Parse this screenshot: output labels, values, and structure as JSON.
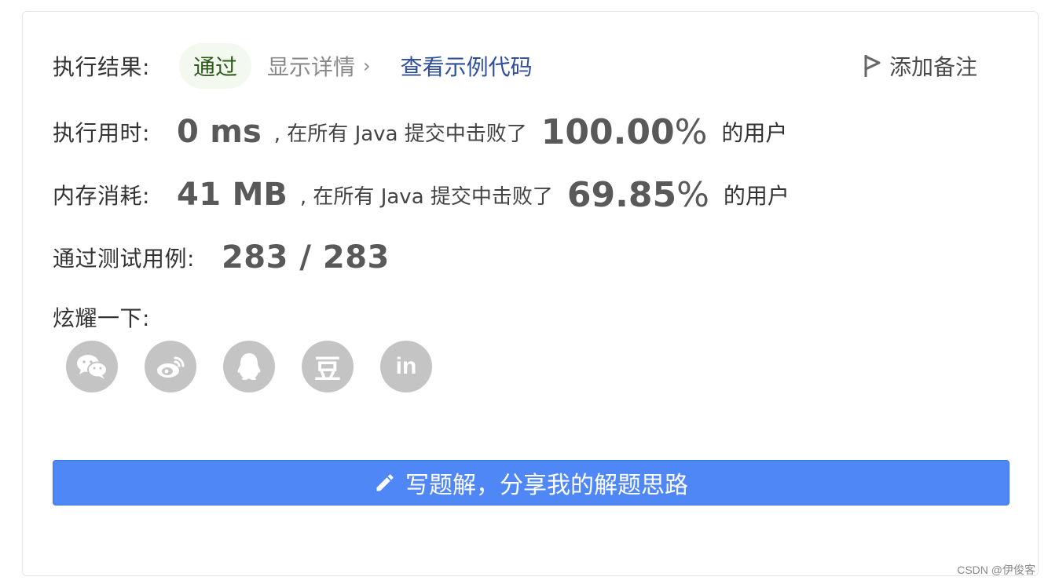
{
  "result": {
    "label": "执行结果:",
    "status": "通过",
    "details_label": "显示详情",
    "details_chevron": "›",
    "example_code_label": "查看示例代码",
    "add_note_label": "添加备注"
  },
  "runtime": {
    "label": "执行用时:",
    "value": "0",
    "unit": "ms",
    "mid_text": ", 在所有 Java 提交中击败了",
    "percent_value": "100.00",
    "percent_sign": "%",
    "suffix": "的用户"
  },
  "memory": {
    "label": "内存消耗:",
    "value": "41",
    "unit": "MB",
    "mid_text": ", 在所有 Java 提交中击败了",
    "percent_value": "69.85",
    "percent_sign": "%",
    "suffix": "的用户"
  },
  "tests": {
    "label": "通过测试用例:",
    "value": "283 / 283"
  },
  "share": {
    "label": "炫耀一下:",
    "icons": [
      "wechat-icon",
      "weibo-icon",
      "qq-icon",
      "douban-icon",
      "linkedin-icon"
    ],
    "douban_glyph": "豆",
    "linkedin_glyph": "in"
  },
  "cta": {
    "label": "写题解，分享我的解题思路"
  },
  "watermark": "CSDN @伊俊客",
  "colors": {
    "pass_bg": "#f4f9ef",
    "pass_text": "#2c5a1a",
    "link_blue": "#2f4f9c",
    "cta_bg": "#5087f7",
    "icon_grey": "#c4c4c4"
  }
}
